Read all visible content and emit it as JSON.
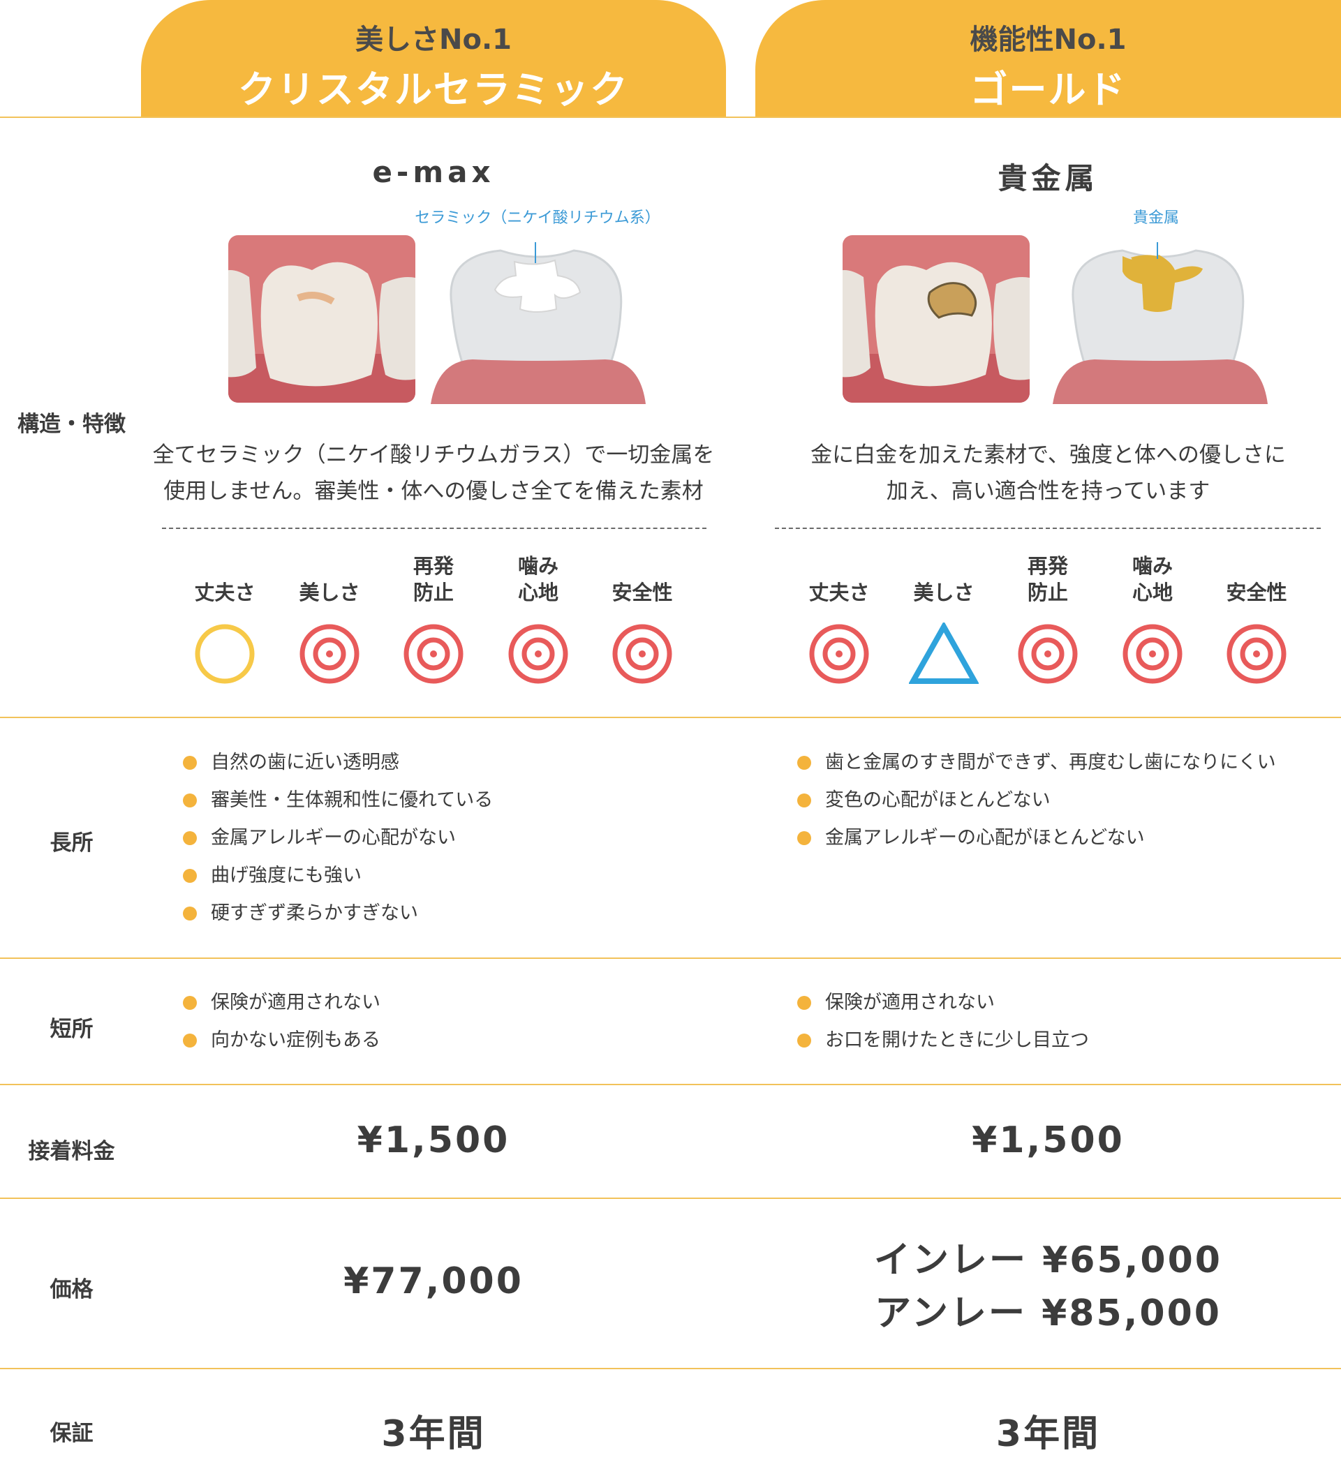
{
  "columns": [
    {
      "tab_sub": "美しさNo.1",
      "tab_title": "クリスタルセラミック",
      "material": "e-max",
      "callout": "セラミック（ニケイ酸リチウム系）",
      "desc_lines": [
        "全てセラミック（ニケイ酸リチウムガラス）で一切金属を",
        "使用しません。審美性・体への優しさ全てを備えた素材"
      ],
      "ratings": [
        {
          "label": "丈夫さ",
          "symbol": "circle"
        },
        {
          "label": "美しさ",
          "symbol": "double-circle"
        },
        {
          "label": "再発\n防止",
          "symbol": "double-circle"
        },
        {
          "label": "噛み\n心地",
          "symbol": "double-circle"
        },
        {
          "label": "安全性",
          "symbol": "double-circle"
        }
      ],
      "merits": [
        "自然の歯に近い透明感",
        "審美性・生体親和性に優れている",
        "金属アレルギーの心配がない",
        "曲げ強度にも強い",
        "硬すぎず柔らかすぎない"
      ],
      "demerits": [
        "保険が適用されない",
        "向かない症例もある"
      ],
      "bonding_fee": "¥1,500",
      "price_lines": [
        "¥77,000"
      ],
      "warranty": "3年間"
    },
    {
      "tab_sub": "機能性No.1",
      "tab_title": "ゴールド",
      "material": "貴金属",
      "callout": "貴金属",
      "desc_lines": [
        "金に白金を加えた素材で、強度と体への優しさに",
        "加え、高い適合性を持っています"
      ],
      "ratings": [
        {
          "label": "丈夫さ",
          "symbol": "double-circle"
        },
        {
          "label": "美しさ",
          "symbol": "triangle"
        },
        {
          "label": "再発\n防止",
          "symbol": "double-circle"
        },
        {
          "label": "噛み\n心地",
          "symbol": "double-circle"
        },
        {
          "label": "安全性",
          "symbol": "double-circle"
        }
      ],
      "merits": [
        "歯と金属のすき間ができず、再度むし歯になりにくい",
        "変色の心配がほとんどない",
        "金属アレルギーの心配がほとんどない"
      ],
      "demerits": [
        "保険が適用されない",
        "お口を開けたときに少し目立つ"
      ],
      "bonding_fee": "¥1,500",
      "price_lines": [
        "インレー ¥65,000",
        "アンレー ¥85,000"
      ],
      "warranty": "3年間"
    }
  ],
  "row_labels": {
    "structure": "構造・特徴",
    "merits": "長所",
    "demerits": "短所",
    "bonding_fee": "接着料金",
    "price": "価格",
    "warranty": "保証"
  },
  "colors": {
    "accent": "#f6b93f",
    "double_circle": "#e85a5a",
    "circle": "#f7c948",
    "triangle": "#2fa3dc",
    "callout": "#3b9ad6",
    "gold": "#e0b23a"
  }
}
